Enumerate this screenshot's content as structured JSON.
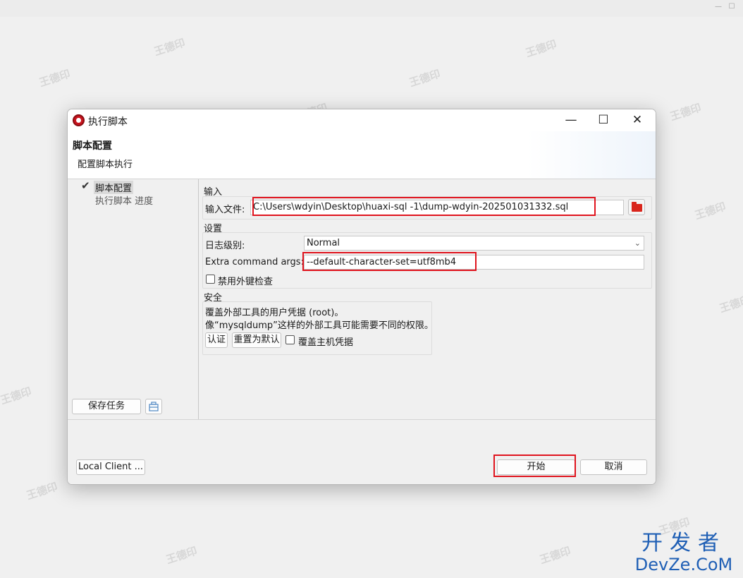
{
  "dialog": {
    "title": "执行脚本",
    "minimize_glyph": "—",
    "maximize_glyph": "☐",
    "close_glyph": "✕"
  },
  "banner": {
    "title": "脚本配置",
    "subtitle": "配置脚本执行"
  },
  "tree": {
    "items": [
      {
        "label": "脚本配置",
        "checked": true,
        "selected": true
      },
      {
        "label": "执行脚本 进度",
        "checked": false,
        "selected": false
      }
    ],
    "check_glyph": "✔"
  },
  "left_buttons": {
    "save_task": "保存任务",
    "task_icon": "toolbox-icon"
  },
  "input_section": {
    "group_title": "输入",
    "file_label": "输入文件:",
    "file_value": "C:\\Users\\wdyin\\Desktop\\huaxi-sql -1\\dump-wdyin-202501031332.sql",
    "folder_icon": "folder-icon",
    "folder_color": "#d9251c"
  },
  "settings_section": {
    "group_title": "设置",
    "log_level_label": "日志级别:",
    "log_level_value": "Normal",
    "extra_args_label": "Extra command args:",
    "extra_args_value": "--default-character-set=utf8mb4",
    "disable_fk_label": "禁用外键检查",
    "disable_fk_checked": false
  },
  "security_section": {
    "group_title": "安全",
    "line1": "覆盖外部工具的用户凭据 (root)。",
    "line2": "像“mysqldump”这样的外部工具可能需要不同的权限。",
    "auth_button": "认证",
    "reset_button": "重置为默认",
    "override_host_label": "覆盖主机凭据",
    "override_host_checked": false
  },
  "footer": {
    "local_client_button": "Local Client ...",
    "start_button": "开始",
    "cancel_button": "取消"
  },
  "watermark_text": "王德印",
  "brand": {
    "top": "开发者",
    "bottom": "DevZe.CoM",
    "color": "#1f5fb5"
  },
  "highlight_color": "#e0141e"
}
